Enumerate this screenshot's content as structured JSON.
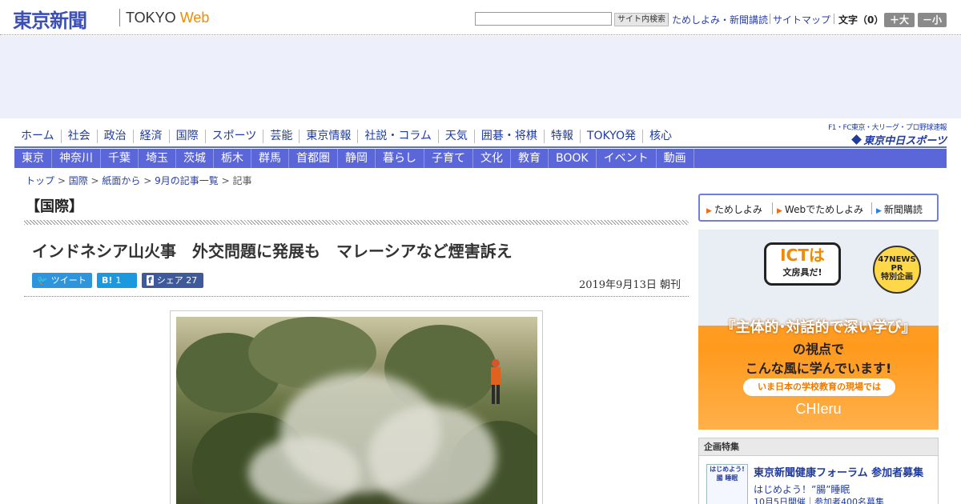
{
  "header": {
    "logo_jp": "東京新聞",
    "logo_en_1": "TOKYO",
    "logo_en_2": "Web",
    "search_button": "サイト内検索",
    "links": [
      "ためしよみ・新聞講読",
      "サイトマップ"
    ],
    "fontsize_label": "文字（0）",
    "larger": "＋大",
    "smaller": "－小"
  },
  "nav_primary": [
    "ホーム",
    "社会",
    "政治",
    "経済",
    "国際",
    "スポーツ",
    "芸能",
    "東京情報",
    "社説・コラム",
    "天気",
    "囲碁・将棋",
    "特報",
    "TOKYO発",
    "核心"
  ],
  "brand": {
    "sub": "F1・FC東京・大リーグ・プロ野球速報",
    "main": "東京中日スポーツ"
  },
  "nav_secondary": [
    "東京",
    "神奈川",
    "千葉",
    "埼玉",
    "茨城",
    "栃木",
    "群馬",
    "首都圏",
    "静岡",
    "暮らし",
    "子育て",
    "文化",
    "教育",
    "BOOK",
    "イベント",
    "動画"
  ],
  "breadcrumb": [
    "トップ",
    "国際",
    "紙面から",
    "9月の記事一覧",
    "記事"
  ],
  "article": {
    "category": "【国際】",
    "headline": "インドネシア山火事　外交問題に発展も　マレーシアなど煙害訴え",
    "date": "2019年9月13日 朝刊",
    "share": {
      "tweet_label": "ツイート",
      "hatena_icon": "B!",
      "hatena_count": "1",
      "fb_label": "シェア",
      "fb_count": "27"
    }
  },
  "sidebar": {
    "links": [
      "ためしよみ",
      "Webでためしよみ",
      "新聞購読"
    ],
    "ad": {
      "bubble_1": "ICTは",
      "bubble_2": "文房具だ!",
      "badge": [
        "47NEWS",
        "PR",
        "特別企画"
      ],
      "main": "『主体的･対話的で深い学び』",
      "line2": "の視点で",
      "line3": "こんな風に学んでいます!",
      "ribbon": "いま日本の学校教育の現場では",
      "brand": "CHIeru"
    },
    "feature": {
      "header": "企画特集",
      "thumb_1": "はじめよう!",
      "thumb_2": "腸 睡眠",
      "title": "東京新聞健康フォーラム 参加者募集",
      "subtitle": "はじめよう！”腸”睡眠",
      "detail": "10月5日開催｜参加者400名募集"
    }
  },
  "colors": {
    "brand_blue": "#3b4fb8",
    "nav_blue": "#5b66d9",
    "accent_orange": "#f08c00"
  }
}
